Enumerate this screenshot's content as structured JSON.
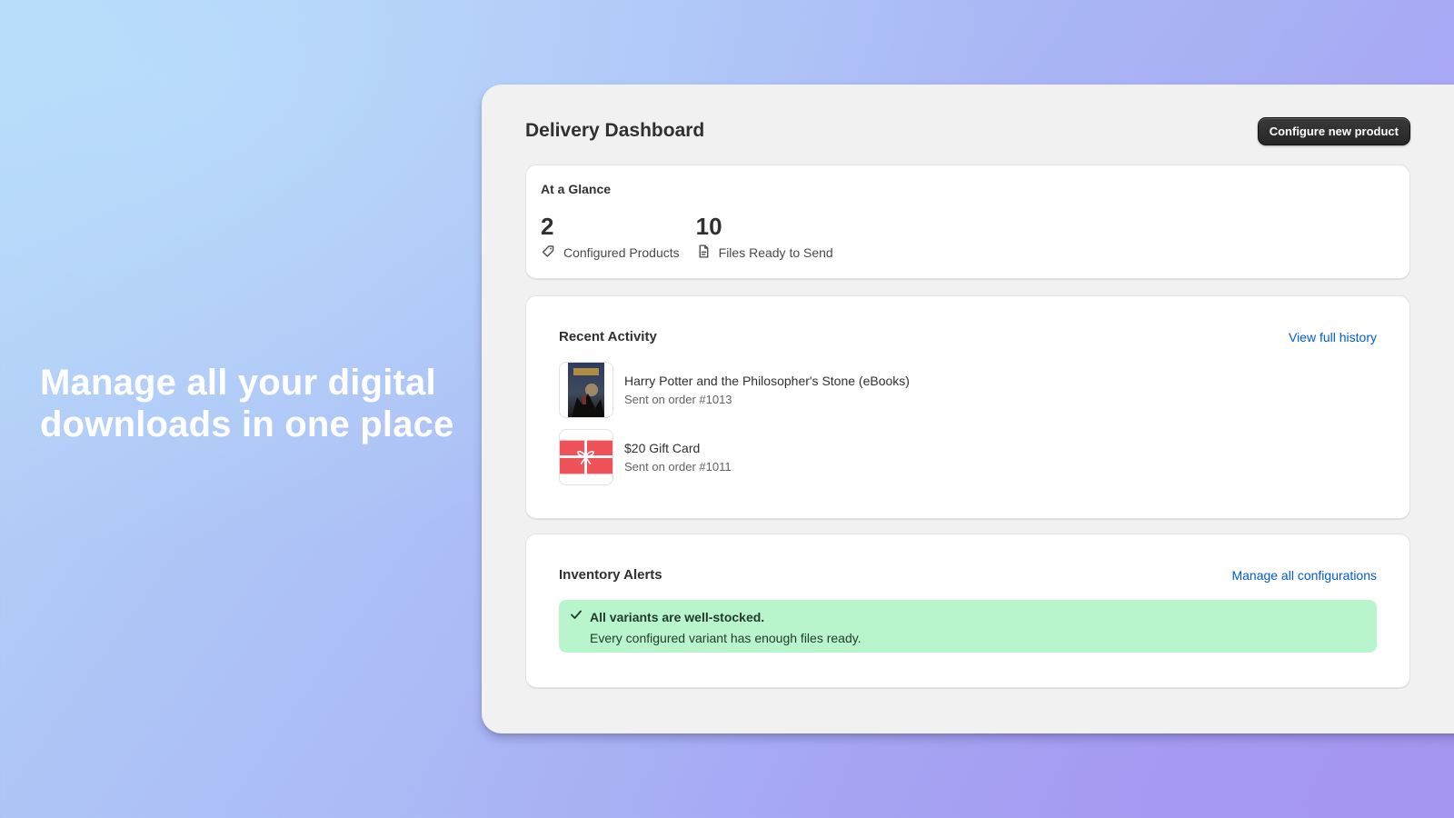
{
  "marketing": {
    "headline": "Manage all your digital downloads in one place"
  },
  "header": {
    "title": "Delivery Dashboard",
    "primary_action": "Configure new product"
  },
  "glance": {
    "title": "At a Glance",
    "stats": [
      {
        "value": "2",
        "label": "Configured Products",
        "icon": "tag-icon"
      },
      {
        "value": "10",
        "label": "Files Ready to Send",
        "icon": "file-icon"
      }
    ]
  },
  "activity": {
    "title": "Recent Activity",
    "link": "View full history",
    "items": [
      {
        "name": "Harry Potter and the Philosopher's Stone (eBooks)",
        "sub": "Sent on order #1013",
        "thumb": "book-cover-thumbnail"
      },
      {
        "name": "$20 Gift Card",
        "sub": "Sent on order #1011",
        "thumb": "gift-card-thumbnail"
      }
    ]
  },
  "inventory": {
    "title": "Inventory Alerts",
    "link": "Manage all configurations",
    "banner": {
      "title": "All variants are well-stocked.",
      "body": "Every configured variant has enough files ready.",
      "icon": "check-icon",
      "color": "#b8f5cc"
    }
  },
  "colors": {
    "accent": "#005bd3",
    "button": "#303030",
    "success": "#b8f5cc"
  }
}
